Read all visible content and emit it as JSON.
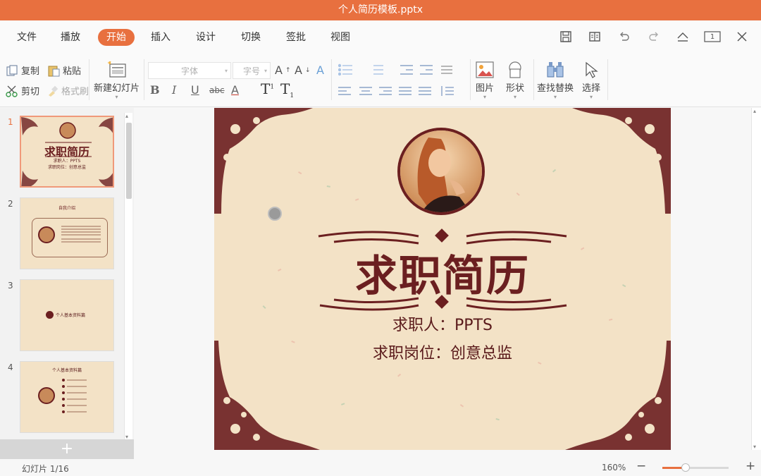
{
  "window": {
    "title": "个人简历模板.pptx"
  },
  "menu": {
    "items": [
      "文件",
      "播放",
      "开始",
      "插入",
      "设计",
      "切换",
      "签批",
      "视图"
    ],
    "active": "开始"
  },
  "ribbon": {
    "copy": "复制",
    "paste": "粘贴",
    "cut": "剪切",
    "format_painter": "格式刷",
    "new_slide": "新建幻灯片",
    "font_placeholder": "字体",
    "size_placeholder": "字号",
    "picture": "图片",
    "shape": "形状",
    "find_replace": "查找替换",
    "select": "选择",
    "bold": "B",
    "italic": "I",
    "underline": "U",
    "strike": "abc",
    "fontcolor": "A"
  },
  "thumbnails": [
    {
      "num": "1",
      "title": "求职简历",
      "line1": "求职人：PPTS",
      "line2": "求职岗位：创意总监"
    },
    {
      "num": "2",
      "title": "自我介绍"
    },
    {
      "num": "3",
      "title": "个人基本资料篇"
    },
    {
      "num": "4",
      "title": "个人基本资料篇"
    }
  ],
  "slide": {
    "title": "求职简历",
    "applicant": "求职人：PPTS",
    "position": "求职岗位：创意总监"
  },
  "window_controls": {
    "slide_count_badge": "1"
  },
  "status": {
    "slide_indicator": "幻灯片 1/16",
    "zoom": "160%",
    "zoom_level": 0.35,
    "zoom_minus": "−",
    "zoom_plus": "+"
  },
  "colors": {
    "accent": "#e8703f",
    "slide_bg": "#f3e2c6",
    "ornament": "#6b1f20"
  }
}
